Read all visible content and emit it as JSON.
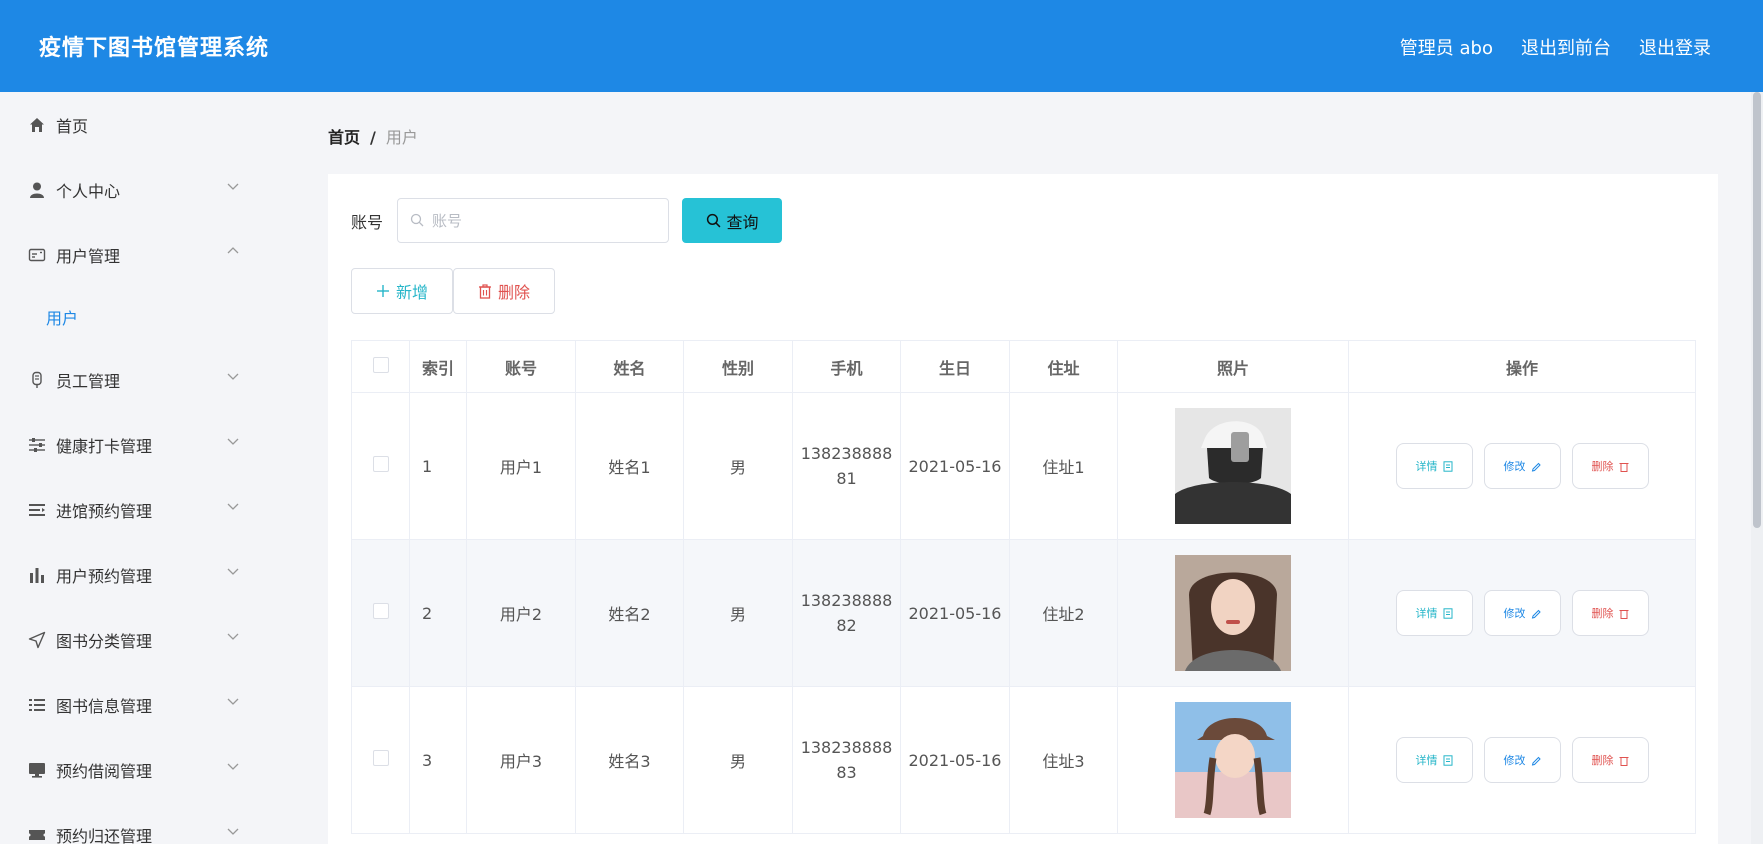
{
  "header": {
    "title": "疫情下图书馆管理系统",
    "admin_label": "管理员 abo",
    "exit_front": "退出到前台",
    "logout": "退出登录"
  },
  "sidebar": {
    "items": [
      {
        "label": "首页",
        "icon": "home-icon"
      },
      {
        "label": "个人中心",
        "icon": "user-icon"
      },
      {
        "label": "用户管理",
        "icon": "id-card-icon"
      },
      {
        "label": "员工管理",
        "icon": "badge-icon"
      },
      {
        "label": "健康打卡管理",
        "icon": "sliders-icon"
      },
      {
        "label": "进馆预约管理",
        "icon": "list-icon"
      },
      {
        "label": "用户预约管理",
        "icon": "bar-chart-icon"
      },
      {
        "label": "图书分类管理",
        "icon": "send-icon"
      },
      {
        "label": "图书信息管理",
        "icon": "menu-icon"
      },
      {
        "label": "预约借阅管理",
        "icon": "monitor-icon"
      },
      {
        "label": "预约归还管理",
        "icon": "ticket-icon"
      }
    ],
    "sub_item": "用户"
  },
  "breadcrumb": {
    "home": "首页",
    "separator": "/",
    "current": "用户"
  },
  "search": {
    "label": "账号",
    "placeholder": "账号",
    "value": "",
    "button": "查询"
  },
  "actions": {
    "add": "新增",
    "delete": "删除"
  },
  "table": {
    "headers": [
      "索引",
      "账号",
      "姓名",
      "性别",
      "手机",
      "生日",
      "住址",
      "照片",
      "操作"
    ],
    "rows": [
      {
        "index": "1",
        "account": "用户1",
        "name": "姓名1",
        "gender": "男",
        "phone_a": "138238888",
        "phone_b": "81",
        "birthday": "2021-05-16",
        "address": "住址1"
      },
      {
        "index": "2",
        "account": "用户2",
        "name": "姓名2",
        "gender": "男",
        "phone_a": "138238888",
        "phone_b": "82",
        "birthday": "2021-05-16",
        "address": "住址2"
      },
      {
        "index": "3",
        "account": "用户3",
        "name": "姓名3",
        "gender": "男",
        "phone_a": "138238888",
        "phone_b": "83",
        "birthday": "2021-05-16",
        "address": "住址3"
      }
    ],
    "ops": {
      "detail": "详情",
      "edit": "修改",
      "remove": "删除"
    }
  },
  "colors": {
    "header_bg": "#1e88e5",
    "accent": "#26c2d6",
    "danger": "#e0524f"
  }
}
